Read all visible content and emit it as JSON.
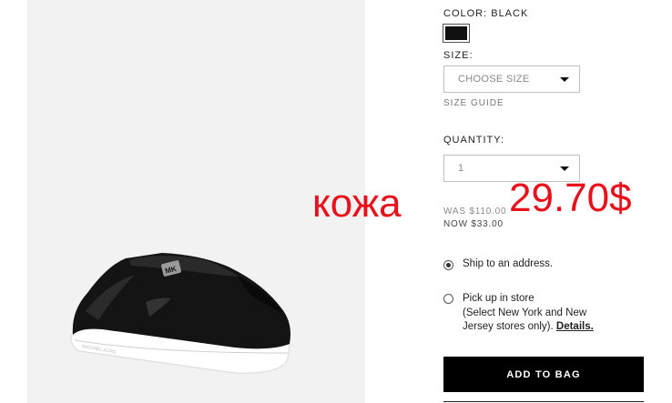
{
  "product": {
    "color_label": "COLOR: BLACK",
    "swatch_color": "#111111",
    "size_label": "SIZE:",
    "size_select_value": "CHOOSE SIZE",
    "size_guide": "SIZE GUIDE",
    "quantity_label": "QUANTITY:",
    "quantity_value": "1",
    "was_price": "WAS $110.00",
    "now_price": "NOW $33.00"
  },
  "overlay": {
    "word": "кожа",
    "price": "29.70$",
    "color": "#e8101a"
  },
  "shipping": {
    "option1": "Ship to an address.",
    "option2_line1": "Pick up in store",
    "option2_line2": "(Select New York and New",
    "option2_line3": "Jersey stores only).",
    "details_link": "Details."
  },
  "actions": {
    "add_to_bag": "ADD TO BAG"
  },
  "shoe": {
    "brand_plate": "MK"
  }
}
